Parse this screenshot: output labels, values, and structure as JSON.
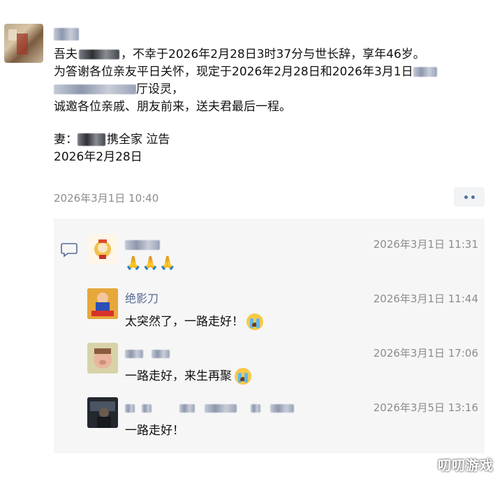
{
  "post": {
    "text": {
      "line1_a": "吾夫",
      "line1_b": "，不幸于2026年2月28日3时37分与世长辞，享年46岁。",
      "line2": "为答谢各位亲友平日关怀，现定于2026年2月28日和2026年3月1日",
      "line3": "厅设灵，",
      "line4": "诚邀各位亲戚、朋友前来，送夫君最后一程。",
      "line5_a": "妻：",
      "line5_b": "携全家 泣告",
      "line6": "2026年2月28日"
    },
    "timestamp": "2026年3月1日 10:40"
  },
  "comments": [
    {
      "name": "",
      "time": "2026年3月1日 11:31",
      "text": "🙏🙏🙏"
    },
    {
      "name": "绝影刀",
      "time": "2026年3月1日 11:44",
      "text": "太突然了，一路走好！"
    },
    {
      "name": "",
      "time": "2026年3月1日 17:06",
      "text": "一路走好，来生再聚"
    },
    {
      "name": "",
      "time": "2026年3月5日 13:16",
      "text": "一路走好！"
    }
  ],
  "watermark": "叨叨游戏",
  "colors": {
    "name_link": "#576b95",
    "timestamp": "#8c8c8c",
    "comment_bg": "#f6f6f7"
  },
  "icons": [
    "comment-bubble-icon",
    "more-icon",
    "crying-emoji-icon",
    "pray-emoji-icon"
  ]
}
